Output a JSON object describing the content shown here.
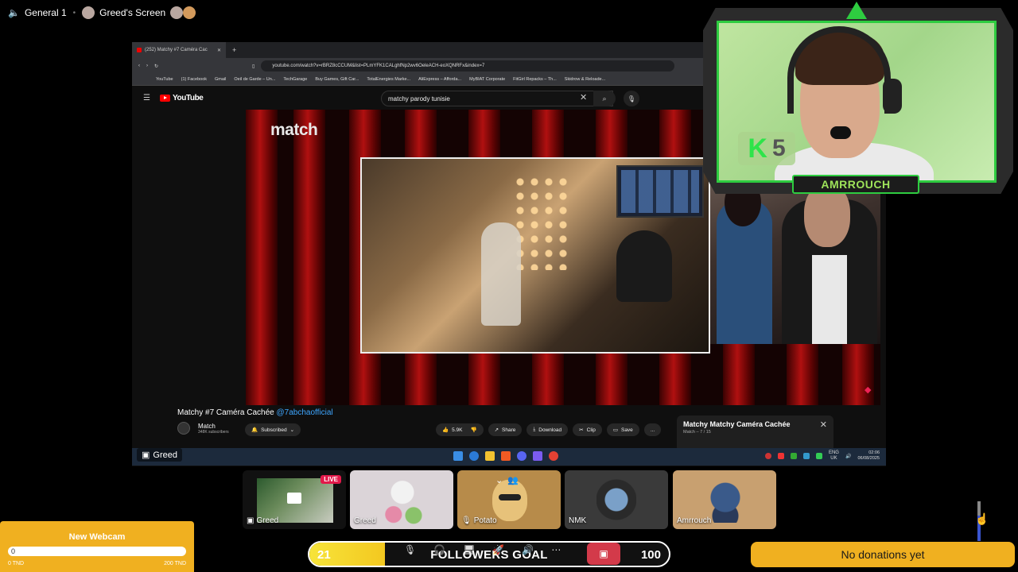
{
  "topbar": {
    "channel": "General 1",
    "screen_label": "Greed's Screen"
  },
  "browser": {
    "tab_title": "(252) Matchy #7 Caméra Cac",
    "url": "youtube.com/watch?v=rBRZ8cCCUM&list=PLmYFK1CALghfNp2wv6OeleACH-eoXQNRFx&index=7",
    "bookmarks": [
      "YouTube",
      "(1) Facebook",
      "Gmail",
      "Oeil de Garde – Un...",
      "TechGarage",
      "Buy Games, Gift Car...",
      "TotalEnergies Marke...",
      "AliExpress – Afforda...",
      "MyBIAT Corporate",
      "FitGirl Repacks – Th...",
      "Skidrow & Reloade..."
    ],
    "youtube_logo": "YouTube",
    "search_value": "matchy parody tunisie",
    "player_logo": "match"
  },
  "video": {
    "title": "Matchy #7 Caméra Cachée",
    "handle": "@7abchaofficial",
    "channel_name": "Match",
    "subscribers": "348K subscribers",
    "subscribed_label": "Subscribed",
    "likes": "5.9K",
    "share": "Share",
    "download": "Download",
    "clip": "Clip",
    "save": "Save",
    "more": "...",
    "playlist_title": "Matchy Matchy Caméra Cachée",
    "playlist_sub": "Match – 7 / 15"
  },
  "taskbar": {
    "lang_top": "ENG",
    "lang_bottom": "UK",
    "time": "02:06",
    "date": "06/08/2025"
  },
  "stream_label": "Greed",
  "webcam": {
    "badge_letter": "K",
    "badge_number": "5",
    "name": "AMRROUCH"
  },
  "tiles": [
    {
      "name": "Greed",
      "live": "LIVE"
    },
    {
      "name": "Greed"
    },
    {
      "name": "Potato"
    },
    {
      "name": "NMK"
    },
    {
      "name": "Amrrouch"
    }
  ],
  "donation": {
    "title": "New Webcam",
    "current": "0",
    "min_label": "0 TND",
    "max_label": "200 TND"
  },
  "followers_goal": {
    "current": "21",
    "label": "FOLLOWERS GOAL",
    "target": "100",
    "progress": 0.21
  },
  "no_donations": "No donations yet",
  "colors": {
    "accent_green": "#2ecc40",
    "donation_yellow": "#f0b020",
    "goal_yellow": "#f7e43a",
    "live_red": "#e2194a",
    "link_blue": "#3ea6ff"
  }
}
